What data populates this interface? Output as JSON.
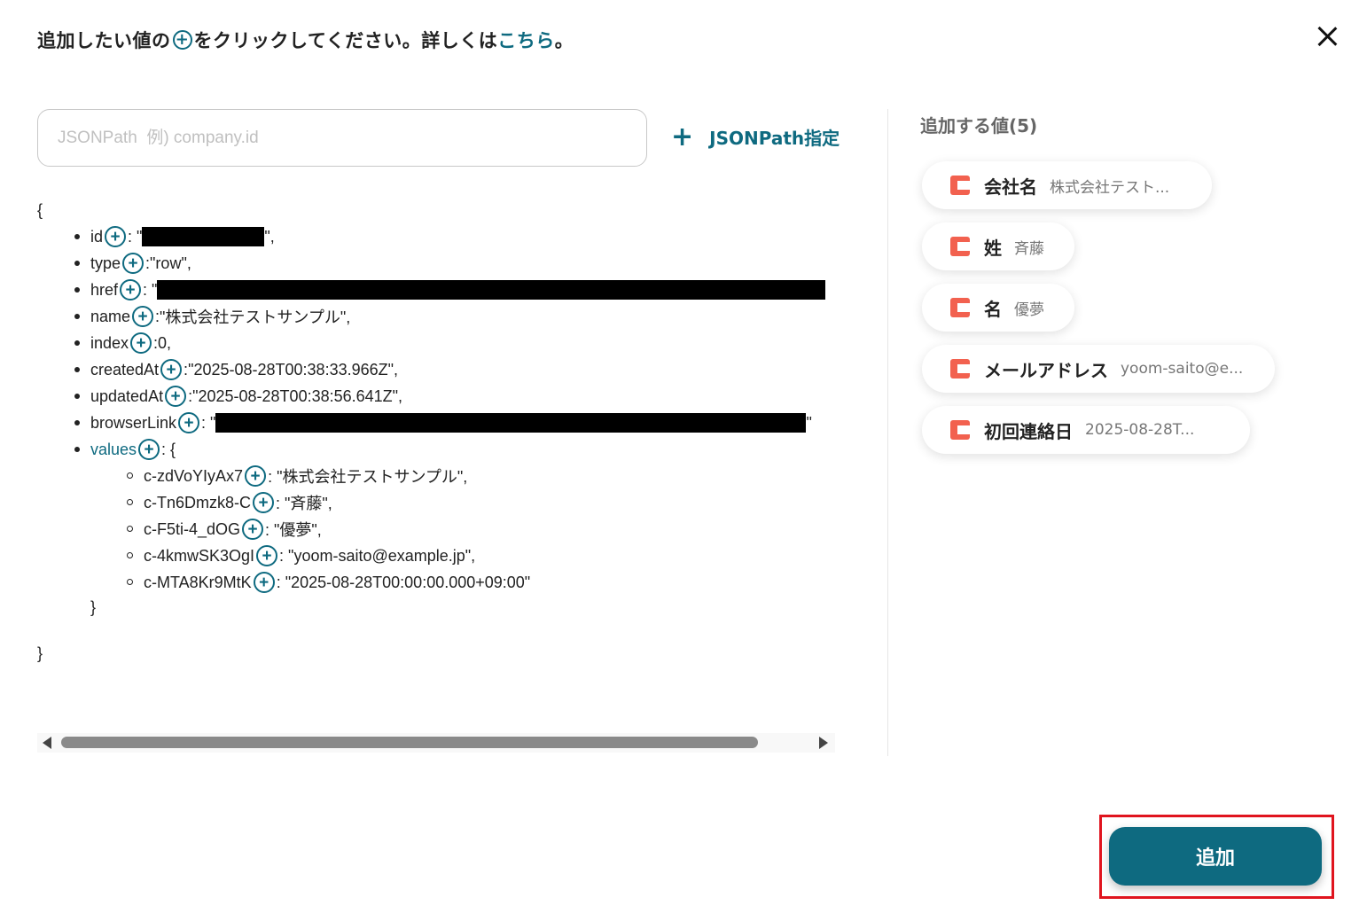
{
  "header": {
    "text_before": "追加したい値の",
    "plus_icon": "+",
    "text_after": "をクリックしてください。詳しくは",
    "link_text": "こちら",
    "text_end": "。"
  },
  "search": {
    "placeholder": "JSONPath  例) company.id",
    "value": ""
  },
  "jsonpath_button": {
    "icon": "+",
    "label": "JSONPath指定"
  },
  "json": {
    "open_brace": "{",
    "close_brace": "}",
    "fields": [
      {
        "key": "id",
        "sep": ": \"",
        "value": "",
        "redacted": true,
        "tail": "\","
      },
      {
        "key": "type",
        "sep": ": ",
        "value": "\"row\",",
        "redacted": false,
        "tail": ""
      },
      {
        "key": "href",
        "sep": ": \"",
        "value": "",
        "redacted": true,
        "tail": ""
      },
      {
        "key": "name",
        "sep": ": ",
        "value": "\"株式会社テストサンプル\",",
        "redacted": false,
        "tail": ""
      },
      {
        "key": "index",
        "sep": ": ",
        "value": "0,",
        "redacted": false,
        "tail": ""
      },
      {
        "key": "createdAt",
        "sep": ": ",
        "value": "\"2025-08-28T00:38:33.966Z\",",
        "redacted": false,
        "tail": ""
      },
      {
        "key": "updatedAt",
        "sep": ": ",
        "value": "\"2025-08-28T00:38:56.641Z\",",
        "redacted": false,
        "tail": ""
      },
      {
        "key": "browserLink",
        "sep": ": \"",
        "value": "",
        "redacted": true,
        "tail": "\""
      },
      {
        "key": "values",
        "sep": ": {",
        "value": "",
        "redacted": false,
        "tail": ""
      }
    ],
    "sub_fields": [
      {
        "key": "c-zdVoYIyAx7",
        "value": ": \"株式会社テストサンプル\","
      },
      {
        "key": "c-Tn6Dmzk8-C",
        "value": ": \"斉藤\","
      },
      {
        "key": "c-F5ti-4_dOG",
        "value": ": \"優夢\","
      },
      {
        "key": "c-4kmwSK3OgI",
        "value": ": \"yoom-saito@example.jp\","
      },
      {
        "key": "c-MTA8Kr9MtK",
        "value": ": \"2025-08-28T00:00:00.000+09:00\""
      }
    ],
    "sub_close": "}"
  },
  "selected": {
    "heading": "追加する値(5)",
    "chips": [
      {
        "label": "会社名",
        "value": "株式会社テスト..."
      },
      {
        "label": "姓",
        "value": "斉藤"
      },
      {
        "label": "名",
        "value": "優夢"
      },
      {
        "label": "メールアドレス",
        "value": "yoom-saito@e..."
      },
      {
        "label": "初回連絡日",
        "value": "2025-08-28T..."
      }
    ]
  },
  "footer": {
    "add_label": "追加"
  },
  "colors": {
    "accent": "#0e6a80",
    "chip_icon": "#f2614f",
    "highlight": "#e0141e"
  },
  "icons": {
    "close": "close-icon",
    "plus": "plus-circle-icon",
    "chip": "app-logo-icon"
  }
}
